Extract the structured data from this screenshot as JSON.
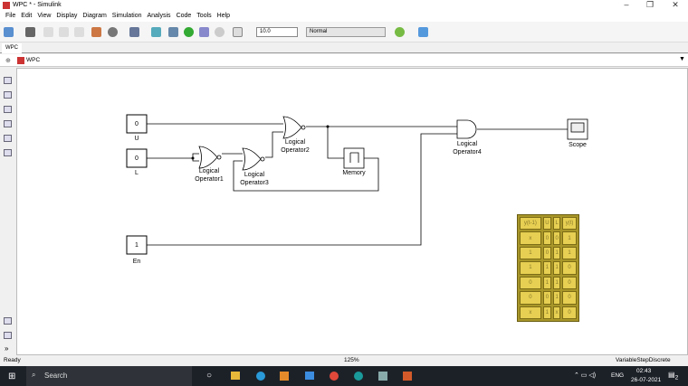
{
  "window": {
    "title": "WPC * - Simulink"
  },
  "menu": [
    "File",
    "Edit",
    "View",
    "Display",
    "Diagram",
    "Simulation",
    "Analysis",
    "Code",
    "Tools",
    "Help"
  ],
  "toolbar": {
    "stop_time": "10.0",
    "sim_mode": "Normal"
  },
  "tab": "WPC",
  "address": "WPC",
  "blocks": {
    "u": {
      "value": "0",
      "label": "U"
    },
    "l": {
      "value": "0",
      "label": "L"
    },
    "en": {
      "value": "1",
      "label": "En"
    },
    "op1": {
      "label1": "Logical",
      "label2": "Operator1"
    },
    "op2": {
      "label1": "Logical",
      "label2": "Operator2"
    },
    "op3": {
      "label1": "Logical",
      "label2": "Operator3"
    },
    "op4": {
      "label1": "Logical",
      "label2": "Operator4"
    },
    "memory": {
      "label": "Memory"
    },
    "scope": {
      "label": "Scope"
    }
  },
  "truth_table": {
    "headers": [
      "y(t-1)",
      "U",
      "L",
      "y(t)"
    ],
    "rows": [
      [
        "x",
        "0",
        "0",
        "1"
      ],
      [
        "1",
        "0",
        "1",
        "1"
      ],
      [
        "1",
        "1",
        "1",
        "0"
      ],
      [
        "0",
        "1",
        "1",
        "0"
      ],
      [
        "0",
        "0",
        "1",
        "0"
      ],
      [
        "x",
        "1",
        "x",
        "0"
      ]
    ]
  },
  "status": {
    "left": "Ready",
    "zoom": "125%",
    "solver": "VariableStepDiscrete"
  },
  "taskbar": {
    "search": "Search",
    "lang": "ENG",
    "time": "02:43",
    "date": "26-07-2021",
    "notifications": "2"
  }
}
